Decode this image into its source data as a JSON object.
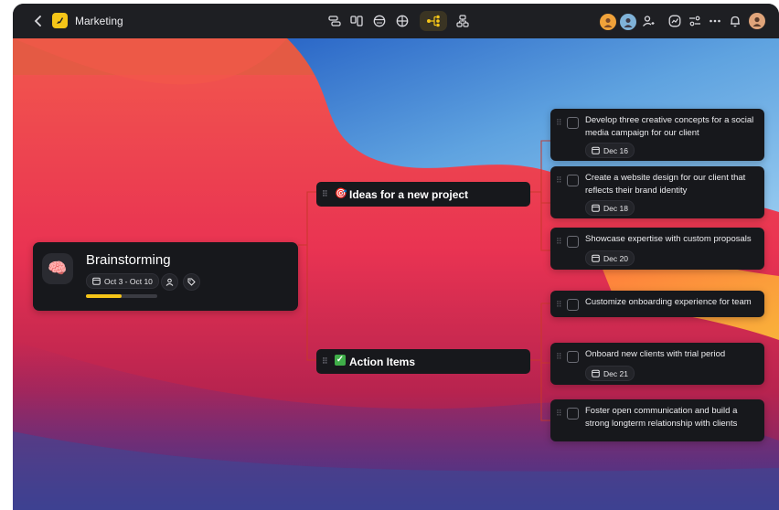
{
  "header": {
    "back_icon": "chevron-left-icon",
    "workspace_icon": "rocket-icon",
    "workspace_color": "#f5c518",
    "title": "Marketing",
    "view_icons": [
      "timeline-view-icon",
      "board-view-icon",
      "calendar-view-icon",
      "globe-view-icon",
      "mindmap-view-icon",
      "hierarchy-view-icon"
    ],
    "active_view": "mindmap-view-icon",
    "accent": "#f5c518",
    "right_icons": [
      "avatar-1",
      "avatar-2",
      "share-users-icon",
      "activity-icon",
      "filter-icon",
      "more-icon",
      "bell-icon",
      "profile-avatar"
    ]
  },
  "root": {
    "emoji": "🧠",
    "title": "Brainstorming",
    "date_range": "Oct 3 - Oct 10",
    "progress": 0.5,
    "progress_color": "#f5c518"
  },
  "branches": [
    {
      "emoji": "🎯",
      "title": "Ideas for a new project",
      "tasks": [
        {
          "text": "Develop three creative concepts for a social media campaign for our client",
          "date": "Dec 16"
        },
        {
          "text": "Create a website design for our client that reflects their brand identity",
          "date": "Dec 18"
        },
        {
          "text": "Showcase expertise with custom proposals",
          "date": "Dec 20"
        }
      ]
    },
    {
      "emoji": "✅",
      "title": "Action Items",
      "tasks": [
        {
          "text": "Customize onboarding experience for team",
          "date": ""
        },
        {
          "text": "Onboard new clients with trial period",
          "date": "Dec 21"
        },
        {
          "text": "Foster open communication and build a strong longterm relationship with clients",
          "date": ""
        }
      ]
    }
  ],
  "connector_color": "#c8392b"
}
